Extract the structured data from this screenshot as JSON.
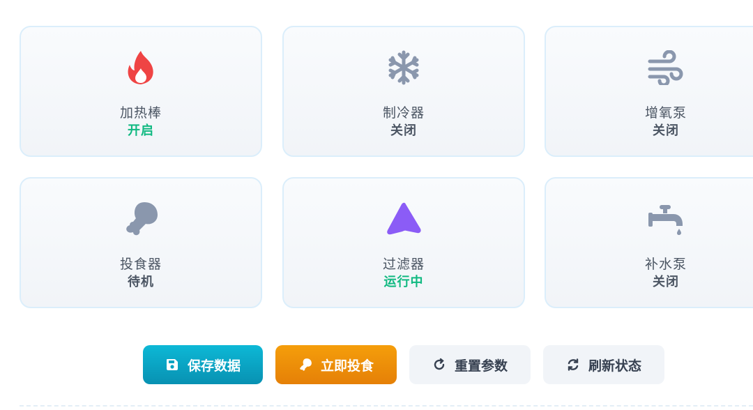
{
  "colors": {
    "status_on": "#10b981",
    "status_off": "#4b5563",
    "icon_gray": "#8a97ad",
    "heater_red": "#ef4444",
    "filter_purple": "#8b5cf6",
    "save_bg": "#0891b2",
    "feed_bg": "#f59e0b"
  },
  "devices": [
    {
      "name": "加热棒",
      "status": "开启",
      "icon": "fire-icon"
    },
    {
      "name": "制冷器",
      "status": "关闭",
      "icon": "snowflake-icon"
    },
    {
      "name": "增氧泵",
      "status": "关闭",
      "icon": "wind-icon"
    },
    {
      "name": "投食器",
      "status": "待机",
      "icon": "drumstick-icon"
    },
    {
      "name": "过滤器",
      "status": "运行中",
      "icon": "filter-triangle-icon"
    },
    {
      "name": "补水泵",
      "status": "关闭",
      "icon": "faucet-icon"
    }
  ],
  "actions": {
    "save": {
      "label": "保存数据",
      "icon": "save-icon"
    },
    "feed": {
      "label": "立即投食",
      "icon": "drumstick-icon"
    },
    "reset": {
      "label": "重置参数",
      "icon": "redo-icon"
    },
    "refresh": {
      "label": "刷新状态",
      "icon": "sync-icon"
    }
  }
}
